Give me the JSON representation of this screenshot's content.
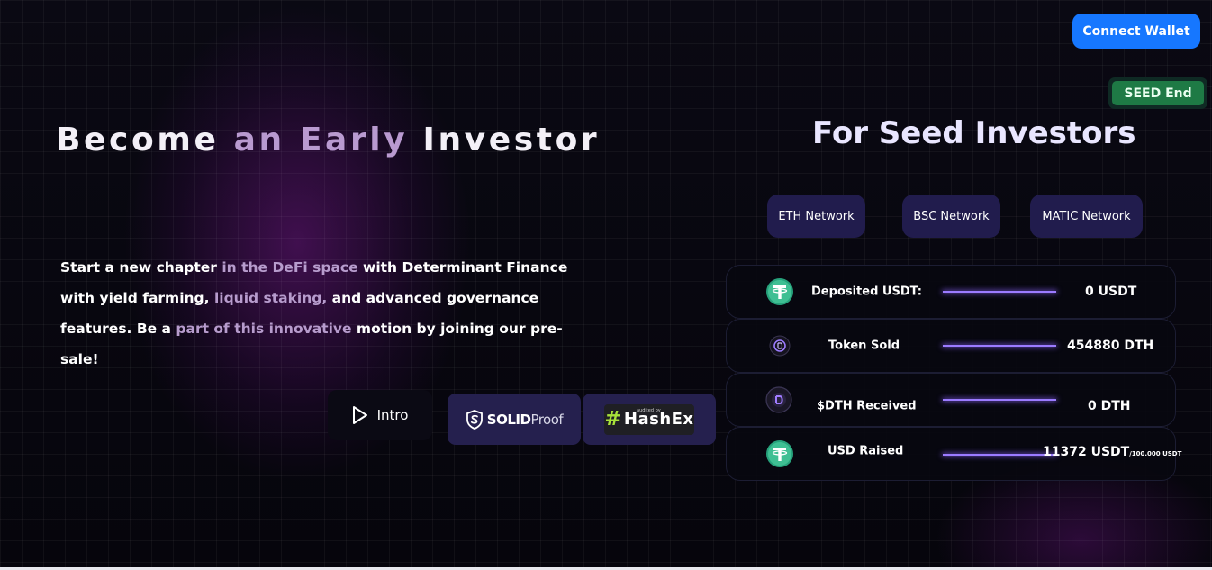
{
  "header": {
    "connect_wallet_label": "Connect Wallet",
    "seed_status": "SEED End"
  },
  "hero": {
    "title_parts": [
      "Become",
      "an Early",
      "Investor"
    ],
    "description_parts": [
      "Start a new chapter ",
      "in the DeFi space",
      " with Determinant Finance with yield farming, ",
      "liquid staking,",
      " and advanced governance features. Be a ",
      "part of this innovative",
      " motion by joining our pre-sale!"
    ],
    "intro_label": "Intro",
    "audits": {
      "solidproof_bold": "SOLID",
      "solidproof_light": "Proof",
      "hashex_small": "audited by",
      "hashex_name": "HashEx"
    }
  },
  "seed": {
    "title": "For Seed Investors",
    "networks": [
      "ETH Network",
      "BSC Network",
      "MATIC Network"
    ],
    "stats": [
      {
        "label": "Deposited USDT:",
        "value": "0 USDT",
        "icon": "usdt-icon"
      },
      {
        "label": "Token Sold",
        "value": "454880 DTH",
        "icon": "dth-token-icon"
      },
      {
        "label": "$DTH Received",
        "value": "0 DTH",
        "icon": "dth-coin-icon"
      },
      {
        "label": "USD Raised",
        "value": "11372 USDT",
        "value_sub": "/100.000 USDT",
        "icon": "usdt-icon"
      }
    ]
  },
  "colors": {
    "accent_blue": "#1677ff",
    "accent_purple": "#b99ad0",
    "network_bg": "#211c4d",
    "seed_badge": "#1e7a45",
    "usdt_green": "#26a17b"
  }
}
